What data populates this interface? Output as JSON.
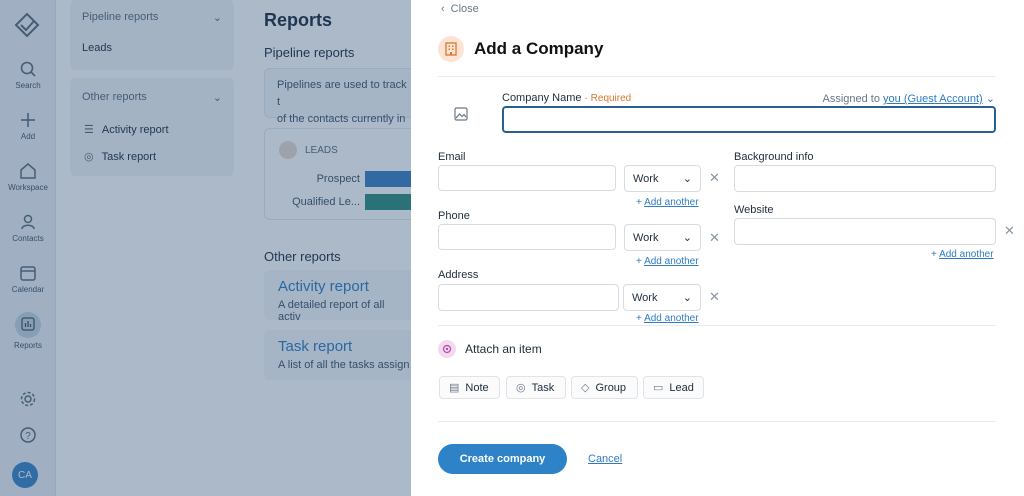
{
  "rail": {
    "items": [
      {
        "label": "Search",
        "icon": "search-icon"
      },
      {
        "label": "Add",
        "icon": "plus-icon"
      },
      {
        "label": "Workspace",
        "icon": "home-icon"
      },
      {
        "label": "Contacts",
        "icon": "person-icon"
      },
      {
        "label": "Calendar",
        "icon": "calendar-icon"
      },
      {
        "label": "Reports",
        "icon": "reports-icon"
      }
    ],
    "avatar": "CA"
  },
  "subnav": {
    "pipeline_header": "Pipeline reports",
    "leads": "Leads",
    "other_header": "Other reports",
    "activity": "Activity report",
    "task": "Task report"
  },
  "main": {
    "title": "Reports",
    "pipeline_section": "Pipeline reports",
    "pipeline_desc_1": "Pipelines are used to track t",
    "pipeline_desc_2": "of the contacts currently in",
    "leads_chip": "LEADS",
    "stage_1": "Prospect",
    "stage_2": "Qualified Le...",
    "other_section": "Other reports",
    "activity_title": "Activity report",
    "activity_desc": "A detailed report of all activ",
    "task_title": "Task report",
    "task_desc": "A list of all the tasks assign"
  },
  "drawer": {
    "close": "Close",
    "title": "Add a Company",
    "company_label": "Company Name",
    "required": "· Required",
    "assigned_prefix": "Assigned to",
    "assigned_user": "you (Guest Account)",
    "email_label": "Email",
    "phone_label": "Phone",
    "address_label": "Address",
    "work": "Work",
    "add_another": "Add another",
    "background_label": "Background info",
    "website_label": "Website",
    "attach_label": "Attach an item",
    "chips": [
      "Note",
      "Task",
      "Group",
      "Lead"
    ],
    "create": "Create company",
    "cancel": "Cancel"
  },
  "colors": {
    "accent": "#2d82c8",
    "overlay": "#224870",
    "required": "#d8782e"
  }
}
